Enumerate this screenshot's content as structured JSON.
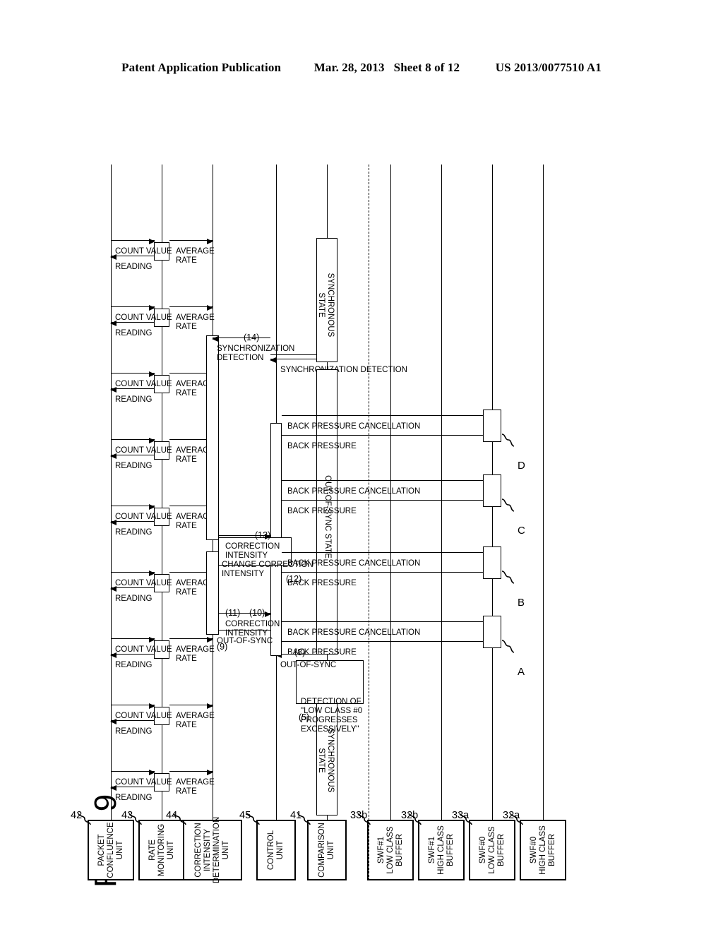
{
  "header": {
    "publication": "Patent Application Publication",
    "date": "Mar. 28, 2013",
    "sheet": "Sheet 8 of 12",
    "patent_number": "US 2013/0077510 A1"
  },
  "figure": {
    "label": "FIG. 9",
    "actors": [
      {
        "id": "packet-confluence-unit",
        "ref": "42",
        "lines": [
          "PACKET",
          "CONFLUENCE",
          "UNIT"
        ]
      },
      {
        "id": "rate-monitoring-unit",
        "ref": "43",
        "lines": [
          "RATE",
          "MONITORING",
          "UNIT"
        ]
      },
      {
        "id": "correction-intensity-determination-unit",
        "ref": "44",
        "lines": [
          "CORRECTION",
          "INTENSITY",
          "DETERMINATION",
          "UNIT"
        ]
      },
      {
        "id": "control-unit",
        "ref": "45",
        "lines": [
          "CONTROL",
          "UNIT"
        ]
      },
      {
        "id": "comparison-unit",
        "ref": "41",
        "lines": [
          "COMPARISON",
          "UNIT"
        ]
      },
      {
        "id": "swf1-low-class-buffer",
        "ref": "33b",
        "lines": [
          "SWF#1",
          "LOW CLASS",
          "BUFFER"
        ]
      },
      {
        "id": "swf1-high-class-buffer",
        "ref": "32b",
        "lines": [
          "SWF#1",
          "HIGH CLASS",
          "BUFFER"
        ]
      },
      {
        "id": "swf0-low-class-buffer",
        "ref": "33a",
        "lines": [
          "SWF#0",
          "LOW CLASS",
          "BUFFER"
        ]
      },
      {
        "id": "swf0-high-class-buffer",
        "ref": "32a",
        "lines": [
          "SWF#0",
          "HIGH CLASS",
          "BUFFER"
        ]
      }
    ],
    "messages": {
      "reading": "READING",
      "count_value": "COUNT VALUE",
      "average_rate_l1": "AVERAGE",
      "average_rate_l2": "RATE",
      "out_of_sync": "OUT-OF-SYNC",
      "correction_intensity_l1": "CORRECTION",
      "correction_intensity_l2": "INTENSITY",
      "change_correction_intensity_l1": "CHANGE CORRECTION",
      "change_correction_intensity_l2": "INTENSITY",
      "synchronization_detection_one_line": "SYNCHRONIZATION DETECTION",
      "synchronization_detection_l1": "SYNCHRONIZATION",
      "synchronization_detection_l2": "DETECTION",
      "back_pressure": "BACK PRESSURE",
      "back_pressure_cancellation": "BACK PRESSURE CANCELLATION"
    },
    "notes": {
      "synchronous_state_l1": "SYNCHRONOUS",
      "synchronous_state_l2": "STATE",
      "out_of_sync_state": "OUT-OF-SYNC STATE",
      "detection_note": [
        "DETECTION OF",
        "\"LOW CLASS #0",
        "PROGRESSES",
        "EXCESSIVELY\""
      ]
    },
    "steps": {
      "s5": "(5)",
      "s8": "(8)",
      "s9": "(9)",
      "s10": "(10)",
      "s11": "(11)",
      "s12": "(12)",
      "s13": "(13)",
      "s14": "(14)"
    },
    "terminals": [
      "A",
      "B",
      "C",
      "D"
    ],
    "poll_cycle_count": 9,
    "colors": {
      "ink": "#000000",
      "paper": "#ffffff"
    }
  }
}
